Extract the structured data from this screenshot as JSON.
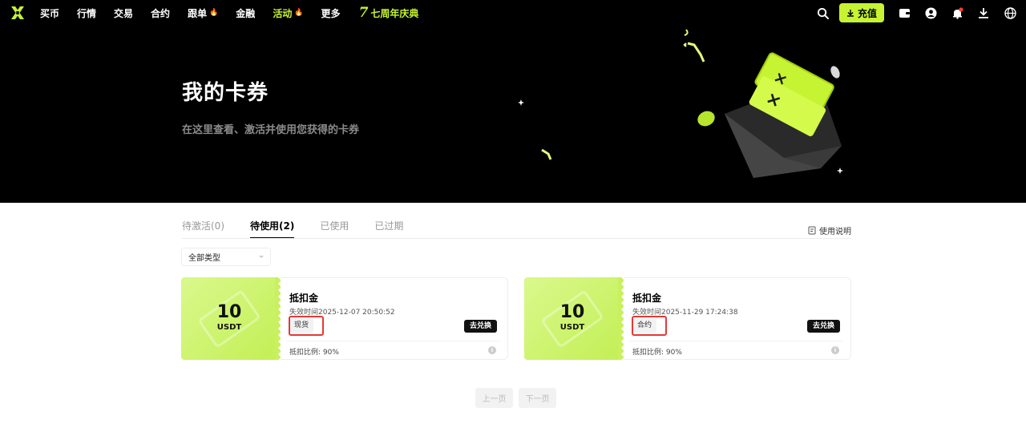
{
  "nav": {
    "items": [
      {
        "label": "买币",
        "active": false,
        "hot": false
      },
      {
        "label": "行情",
        "active": false,
        "hot": false
      },
      {
        "label": "交易",
        "active": false,
        "hot": false
      },
      {
        "label": "合约",
        "active": false,
        "hot": false
      },
      {
        "label": "跟单",
        "active": false,
        "hot": true
      },
      {
        "label": "金融",
        "active": false,
        "hot": false
      },
      {
        "label": "活动",
        "active": true,
        "hot": true
      },
      {
        "label": "更多",
        "active": false,
        "hot": false
      }
    ],
    "anniversary_mark": "7",
    "anniversary_label": "七周年庆典",
    "deposit_label": "充值",
    "right_icons": [
      "search-icon",
      "wallet-icon",
      "user-icon",
      "bell-icon",
      "download-icon",
      "globe-icon"
    ],
    "accent": "#c6f432",
    "hot_color": "#f7a600"
  },
  "hero": {
    "title": "我的卡券",
    "subtitle": "在这里查看、激活并使用您获得的卡券"
  },
  "tabs": [
    {
      "label": "待激活(0)",
      "active": false
    },
    {
      "label": "待使用(2)",
      "active": true
    },
    {
      "label": "已使用",
      "active": false
    },
    {
      "label": "已过期",
      "active": false
    }
  ],
  "help_label": "使用说明",
  "filter": {
    "selected": "全部类型"
  },
  "coupons": [
    {
      "amount": "10",
      "unit": "USDT",
      "title": "抵扣金",
      "expiry": "失效时间2025-12-07 20:50:52",
      "tag": "现货",
      "button": "去兑换",
      "ratio": "抵扣比例:  90%"
    },
    {
      "amount": "10",
      "unit": "USDT",
      "title": "抵扣金",
      "expiry": "失效时间2025-11-29 17:24:38",
      "tag": "合约",
      "button": "去兑换",
      "ratio": "抵扣比例:  90%"
    }
  ],
  "pager": {
    "prev": "上一页",
    "next": "下一页"
  }
}
